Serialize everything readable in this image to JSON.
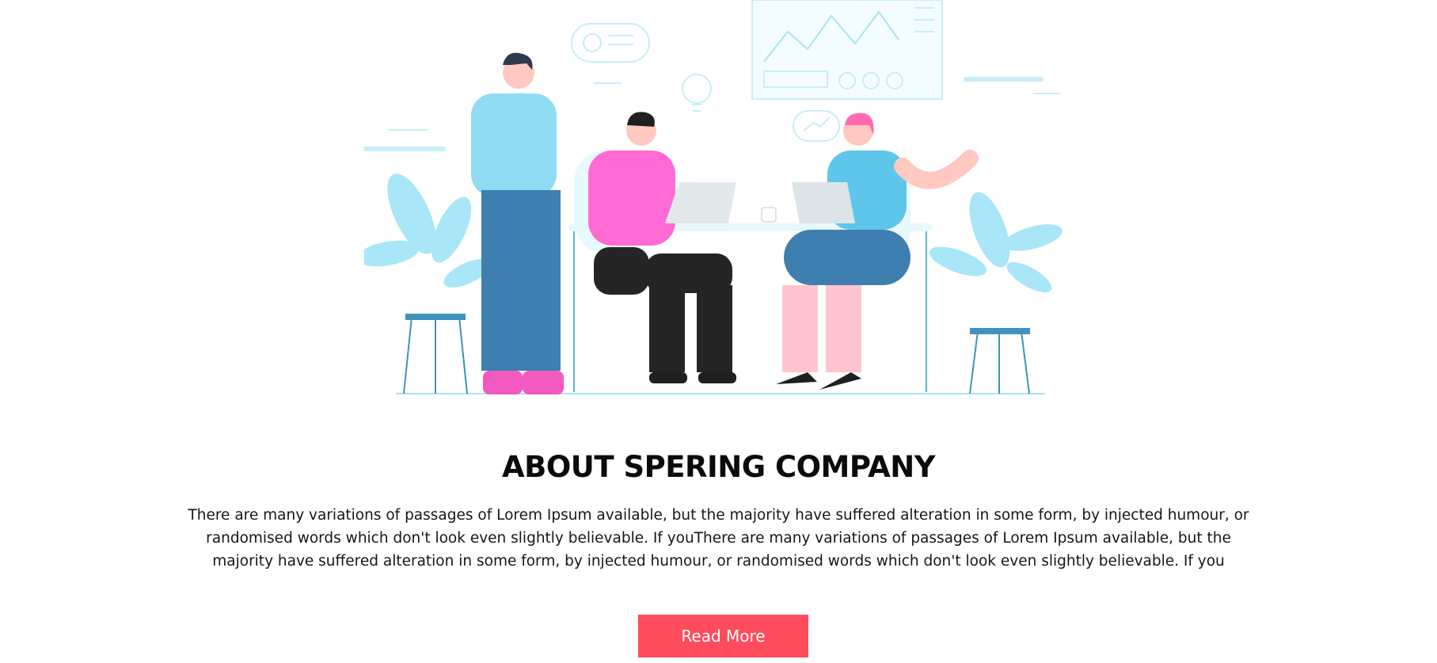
{
  "illustration": {
    "icon": "team-meeting-illustration"
  },
  "about": {
    "title": "ABOUT SPERING COMPANY",
    "description": "There are many variations of passages of Lorem Ipsum available, but the majority have suffered alteration in some form, by injected humour, or randomised words which don't look even slightly believable. If youThere are many variations of passages of Lorem Ipsum available, but the majority have suffered alteration in some form, by injected humour, or randomised words which don't look even slightly believable. If you",
    "button_label": "Read More"
  },
  "colors": {
    "accent": "#fe4c5d",
    "light_blue": "#8fdcf3",
    "pink": "#ff6ad5",
    "denim": "#3f7fb0"
  }
}
